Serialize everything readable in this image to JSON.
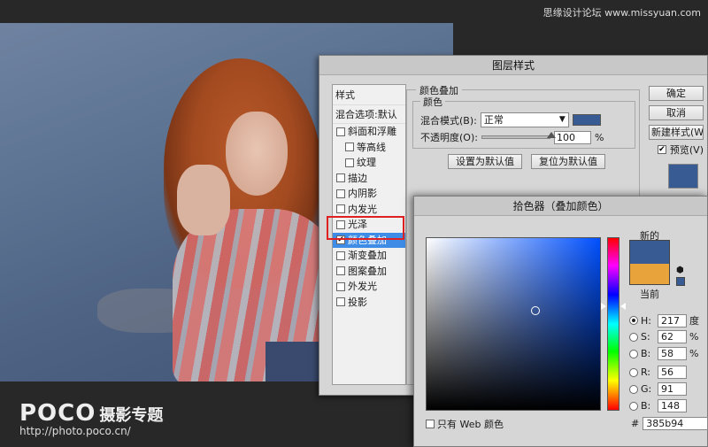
{
  "watermark": "思缘设计论坛 www.missyuan.com",
  "brand": {
    "logo": "POCO",
    "subtitle": "摄影专题",
    "url": "http://photo.poco.cn/"
  },
  "layer_style": {
    "title": "图层样式",
    "styles_header": "样式",
    "blend_default": "混合选项:默认",
    "items": [
      {
        "label": "斜面和浮雕",
        "checked": false,
        "sub": false
      },
      {
        "label": "等高线",
        "checked": false,
        "sub": true
      },
      {
        "label": "纹理",
        "checked": false,
        "sub": true
      },
      {
        "label": "描边",
        "checked": false,
        "sub": false
      },
      {
        "label": "内阴影",
        "checked": false,
        "sub": false
      },
      {
        "label": "内发光",
        "checked": false,
        "sub": false
      },
      {
        "label": "光泽",
        "checked": false,
        "sub": false
      },
      {
        "label": "颜色叠加",
        "checked": true,
        "sub": false,
        "selected": true
      },
      {
        "label": "渐变叠加",
        "checked": false,
        "sub": false
      },
      {
        "label": "图案叠加",
        "checked": false,
        "sub": false
      },
      {
        "label": "外发光",
        "checked": false,
        "sub": false
      },
      {
        "label": "投影",
        "checked": false,
        "sub": false
      }
    ],
    "overlay": {
      "section_title": "颜色叠加",
      "group_title": "颜色",
      "blend_mode_label": "混合模式(B):",
      "blend_mode_value": "正常",
      "opacity_label": "不透明度(O):",
      "opacity_value": "100",
      "opacity_unit": "%",
      "opacity_fraction": 1.0,
      "color": "#385b94",
      "make_default": "设置为默认值",
      "reset_default": "复位为默认值"
    },
    "buttons": {
      "ok": "确定",
      "cancel": "取消",
      "new_style": "新建样式(W)...",
      "preview": "预览(V)"
    },
    "preview_checked": true
  },
  "picker": {
    "title": "拾色器（叠加颜色）",
    "new_label": "新的",
    "current_label": "当前",
    "new_color": "#385b94",
    "current_color": "#e8a43a",
    "fields": [
      {
        "key": "H",
        "label": "H:",
        "value": "217",
        "unit": "度",
        "selected": true
      },
      {
        "key": "S",
        "label": "S:",
        "value": "62",
        "unit": "%",
        "selected": false
      },
      {
        "key": "Bv",
        "label": "B:",
        "value": "58",
        "unit": "%",
        "selected": false
      },
      {
        "key": "R",
        "label": "R:",
        "value": "56",
        "unit": "",
        "selected": false
      },
      {
        "key": "G",
        "label": "G:",
        "value": "91",
        "unit": "",
        "selected": false
      },
      {
        "key": "Bc",
        "label": "B:",
        "value": "148",
        "unit": "",
        "selected": false
      }
    ],
    "web_only_label": "只有 Web 颜色",
    "hex_prefix": "#",
    "hex_value": "385b94",
    "saturation": 0.62,
    "brightness": 0.58,
    "hue_deg": 217
  }
}
